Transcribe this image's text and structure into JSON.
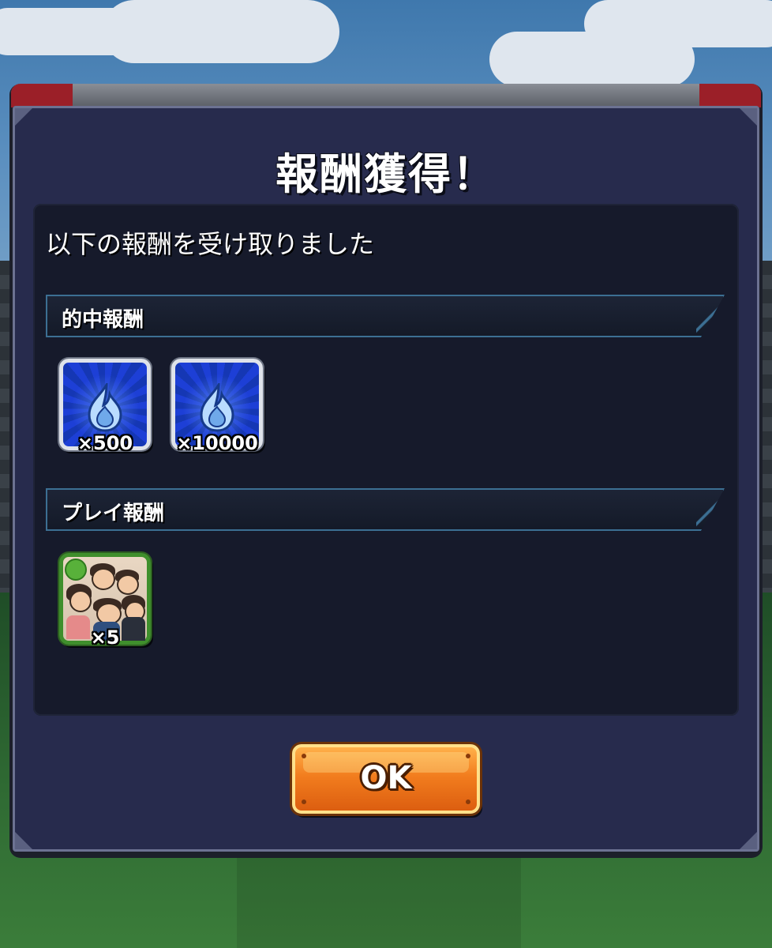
{
  "dialog": {
    "title": "報酬獲得！",
    "subtitle": "以下の報酬を受け取りました",
    "ok_label": "OK"
  },
  "sections": [
    {
      "label": "的中報酬",
      "rewards": [
        {
          "icon": "blue-flame-icon",
          "quantity": "×500"
        },
        {
          "icon": "blue-flame-icon",
          "quantity": "×10000"
        }
      ]
    },
    {
      "label": "プレイ報酬",
      "rewards": [
        {
          "icon": "character-group-icon",
          "quantity": "×5"
        }
      ]
    }
  ],
  "colors": {
    "dialog_bg": "#272b4d",
    "panel_bg": "#161a2b",
    "section_border": "#3c6f93",
    "button_orange": "#f27d1e",
    "reward_blue": "#1d3fd6",
    "reward_green_border": "#3f8f2c"
  }
}
